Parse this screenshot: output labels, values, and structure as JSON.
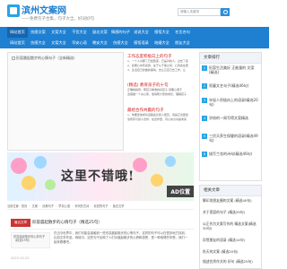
{
  "header": {
    "logo_text": "滨州文案网",
    "subtitle": "——免费句子合集，句子大全，好词好句",
    "search_placeholder": "请输入关键词"
  },
  "nav": {
    "row1": [
      "网站首页",
      "伤感文案",
      "文案大全",
      "干货大全",
      "励志文案",
      "情感的句子",
      "说说大全",
      "感悟大全",
      "名言名句"
    ],
    "row2": [
      "网站首页",
      "伤感大全",
      "文案大全",
      "早安心语",
      "晚安大全",
      "伤感大全",
      "感悟语录",
      "结婚大全",
      "朋友大全"
    ]
  },
  "main": {
    "image_title": "形容晨起散步的心情句子（全新精选）"
  },
  "articles": [
    {
      "title": "工作态度积极向上的句子",
      "lines": [
        "1、一个人对那了已经结束，已是对的人，过去了就",
        "2、如果心中有感激，在于从于事之间，心就会在里",
        "3、生活自己的做的事情，去让它自己去工作，让"
      ]
    },
    {
      "title": "(精选) 教育孩子的十句",
      "lines": [
        "正确地指导、帮孩子精准的好孩子 就要心里不",
        "宽容做一个关心家，懂得帮大家的成长，理解孩子"
      ]
    },
    {
      "title": "最给合作共赢的句子",
      "lines": [
        "1、你要坚信成功道路会比别人更苦，但是它也更加",
        "靠所有与别人合作，在合作里，同心协力共赢未来"
      ]
    }
  ],
  "sidebar": {
    "title": "文章排行",
    "items": [
      {
        "num": "1",
        "text": "形容生活美好 正能量的 文案(精选)"
      },
      {
        "num": "2",
        "text": "男童文艺句子(精选46句)"
      },
      {
        "num": "3",
        "text": "年轻人积极向上的语录(精选20句)"
      },
      {
        "num": "4",
        "text": "学校的一周写得文案精选"
      },
      {
        "num": "5",
        "text": "三伏天养生保健的语录(精选49句)"
      },
      {
        "num": "6",
        "text": "描写兰花的诗句(精选46句)"
      }
    ]
  },
  "banner": {
    "text": "这里不错哦!",
    "ad_label": "AD位置"
  },
  "breadcrumb": [
    "当前位置：首页",
    "文案",
    "优美句子",
    "早安心语",
    "宋代的古诗",
    "安慰的句子",
    "励志文学"
  ],
  "category": {
    "tag": "最近文章",
    "title": "形容晨起散步的心情句子（精选25句）"
  },
  "entry": {
    "thumb_label": "形容晨起散步的心情句子（精选25句）",
    "text": "在当今世界中，我们可能会接触到一些形容晨起散步的心情句子。这样的句子可以在很多地方找到，比如文学作品，网络中。这些句子反映了人们对晨起散步的心情和感受，是一种难得的享受，我们一起来看看吧。",
    "date": "2023-10-23"
  },
  "sidebar2": {
    "title": "相关文章",
    "items": [
      "脚印发朋友圈的文案 (精选40句)",
      "关于宽容的句子 (精选29句)",
      "公正作为文案写作的 精选文案(精选30句)",
      "珍惜朋友的语录 (精选14句)",
      "秋天的文案 (精选20句)",
      "描述优秀作文的 好句 (精选25句)"
    ]
  }
}
